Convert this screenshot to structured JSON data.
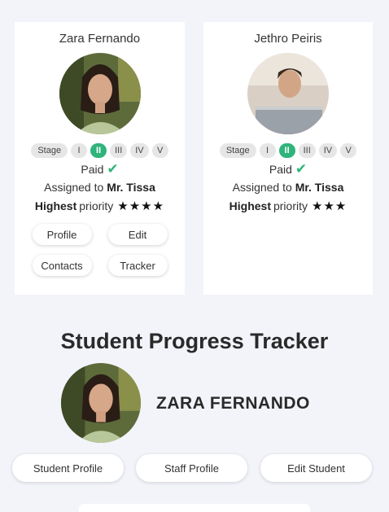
{
  "students": [
    {
      "name": "Zara Fernando",
      "stage_label": "Stage",
      "stages": [
        "I",
        "II",
        "III",
        "IV",
        "V"
      ],
      "active_stage": "II",
      "paid_label": "Paid",
      "assigned_prefix": "Assigned to",
      "assigned_to": "Mr. Tissa",
      "priority_strong": "Highest",
      "priority_word": "priority",
      "stars": "★★★★",
      "buttons": [
        "Profile",
        "Edit",
        "Contacts",
        "Tracker"
      ]
    },
    {
      "name": "Jethro Peiris",
      "stage_label": "Stage",
      "stages": [
        "I",
        "II",
        "III",
        "IV",
        "V"
      ],
      "active_stage": "II",
      "paid_label": "Paid",
      "assigned_prefix": "Assigned to",
      "assigned_to": "Mr. Tissa",
      "priority_strong": "Highest",
      "priority_word": "priority",
      "stars": "★★★"
    }
  ],
  "tracker": {
    "title": "Student Progress Tracker",
    "student_name": "ZARA FERNANDO",
    "actions": [
      "Student Profile",
      "Staff Profile",
      "Edit Student"
    ]
  },
  "colors": {
    "accent_green": "#2fb47b",
    "page_bg": "#f3f4f9",
    "chip_bg": "#e6e6e6"
  },
  "icons": [
    "check-icon",
    "star-icon"
  ]
}
